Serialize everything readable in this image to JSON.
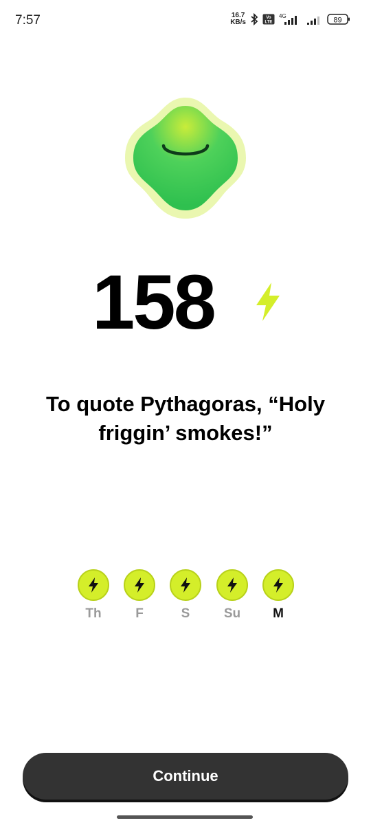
{
  "status_bar": {
    "time": "7:57",
    "net_speed_value": "16.7",
    "net_speed_unit": "KB/s",
    "volte_label": "Vo LTE",
    "network_type": "4G",
    "battery": "89"
  },
  "mascot": {
    "icon": "smiling-green-blob-icon",
    "body_color": "#3ccd55",
    "outline_color": "#eaf7b0"
  },
  "score": {
    "value": "158",
    "icon": "lightning-bolt-icon",
    "accent_color": "#d4ee2a"
  },
  "message": {
    "line1": "To quote Pythagoras, “Holy",
    "line2": "friggin’ smokes!”"
  },
  "streak": {
    "days": [
      {
        "label": "Th",
        "completed": true,
        "current": false
      },
      {
        "label": "F",
        "completed": true,
        "current": false
      },
      {
        "label": "S",
        "completed": true,
        "current": false
      },
      {
        "label": "Su",
        "completed": true,
        "current": false
      },
      {
        "label": "M",
        "completed": true,
        "current": true
      }
    ]
  },
  "continue_button": {
    "label": "Continue"
  }
}
